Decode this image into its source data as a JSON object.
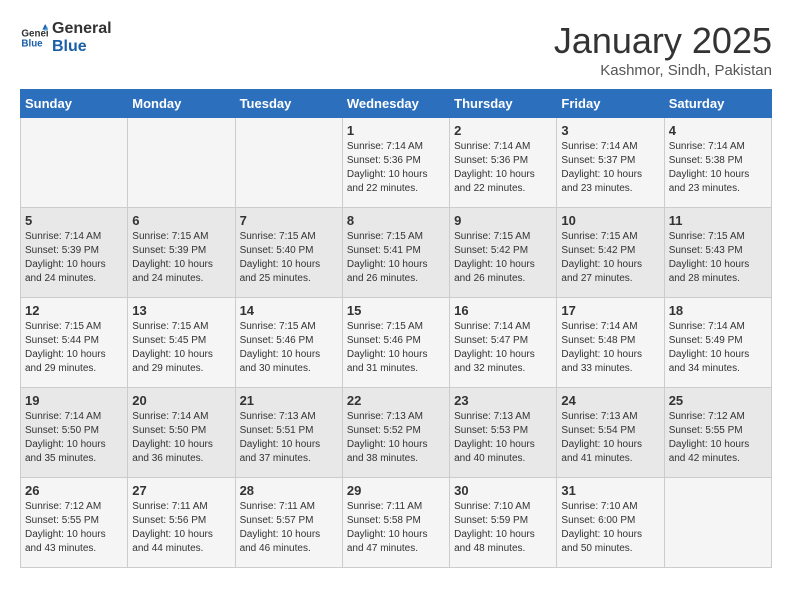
{
  "header": {
    "logo_line1": "General",
    "logo_line2": "Blue",
    "month_title": "January 2025",
    "subtitle": "Kashmor, Sindh, Pakistan"
  },
  "days_of_week": [
    "Sunday",
    "Monday",
    "Tuesday",
    "Wednesday",
    "Thursday",
    "Friday",
    "Saturday"
  ],
  "weeks": [
    [
      {
        "day": "",
        "info": ""
      },
      {
        "day": "",
        "info": ""
      },
      {
        "day": "",
        "info": ""
      },
      {
        "day": "1",
        "info": "Sunrise: 7:14 AM\nSunset: 5:36 PM\nDaylight: 10 hours\nand 22 minutes."
      },
      {
        "day": "2",
        "info": "Sunrise: 7:14 AM\nSunset: 5:36 PM\nDaylight: 10 hours\nand 22 minutes."
      },
      {
        "day": "3",
        "info": "Sunrise: 7:14 AM\nSunset: 5:37 PM\nDaylight: 10 hours\nand 23 minutes."
      },
      {
        "day": "4",
        "info": "Sunrise: 7:14 AM\nSunset: 5:38 PM\nDaylight: 10 hours\nand 23 minutes."
      }
    ],
    [
      {
        "day": "5",
        "info": "Sunrise: 7:14 AM\nSunset: 5:39 PM\nDaylight: 10 hours\nand 24 minutes."
      },
      {
        "day": "6",
        "info": "Sunrise: 7:15 AM\nSunset: 5:39 PM\nDaylight: 10 hours\nand 24 minutes."
      },
      {
        "day": "7",
        "info": "Sunrise: 7:15 AM\nSunset: 5:40 PM\nDaylight: 10 hours\nand 25 minutes."
      },
      {
        "day": "8",
        "info": "Sunrise: 7:15 AM\nSunset: 5:41 PM\nDaylight: 10 hours\nand 26 minutes."
      },
      {
        "day": "9",
        "info": "Sunrise: 7:15 AM\nSunset: 5:42 PM\nDaylight: 10 hours\nand 26 minutes."
      },
      {
        "day": "10",
        "info": "Sunrise: 7:15 AM\nSunset: 5:42 PM\nDaylight: 10 hours\nand 27 minutes."
      },
      {
        "day": "11",
        "info": "Sunrise: 7:15 AM\nSunset: 5:43 PM\nDaylight: 10 hours\nand 28 minutes."
      }
    ],
    [
      {
        "day": "12",
        "info": "Sunrise: 7:15 AM\nSunset: 5:44 PM\nDaylight: 10 hours\nand 29 minutes."
      },
      {
        "day": "13",
        "info": "Sunrise: 7:15 AM\nSunset: 5:45 PM\nDaylight: 10 hours\nand 29 minutes."
      },
      {
        "day": "14",
        "info": "Sunrise: 7:15 AM\nSunset: 5:46 PM\nDaylight: 10 hours\nand 30 minutes."
      },
      {
        "day": "15",
        "info": "Sunrise: 7:15 AM\nSunset: 5:46 PM\nDaylight: 10 hours\nand 31 minutes."
      },
      {
        "day": "16",
        "info": "Sunrise: 7:14 AM\nSunset: 5:47 PM\nDaylight: 10 hours\nand 32 minutes."
      },
      {
        "day": "17",
        "info": "Sunrise: 7:14 AM\nSunset: 5:48 PM\nDaylight: 10 hours\nand 33 minutes."
      },
      {
        "day": "18",
        "info": "Sunrise: 7:14 AM\nSunset: 5:49 PM\nDaylight: 10 hours\nand 34 minutes."
      }
    ],
    [
      {
        "day": "19",
        "info": "Sunrise: 7:14 AM\nSunset: 5:50 PM\nDaylight: 10 hours\nand 35 minutes."
      },
      {
        "day": "20",
        "info": "Sunrise: 7:14 AM\nSunset: 5:50 PM\nDaylight: 10 hours\nand 36 minutes."
      },
      {
        "day": "21",
        "info": "Sunrise: 7:13 AM\nSunset: 5:51 PM\nDaylight: 10 hours\nand 37 minutes."
      },
      {
        "day": "22",
        "info": "Sunrise: 7:13 AM\nSunset: 5:52 PM\nDaylight: 10 hours\nand 38 minutes."
      },
      {
        "day": "23",
        "info": "Sunrise: 7:13 AM\nSunset: 5:53 PM\nDaylight: 10 hours\nand 40 minutes."
      },
      {
        "day": "24",
        "info": "Sunrise: 7:13 AM\nSunset: 5:54 PM\nDaylight: 10 hours\nand 41 minutes."
      },
      {
        "day": "25",
        "info": "Sunrise: 7:12 AM\nSunset: 5:55 PM\nDaylight: 10 hours\nand 42 minutes."
      }
    ],
    [
      {
        "day": "26",
        "info": "Sunrise: 7:12 AM\nSunset: 5:55 PM\nDaylight: 10 hours\nand 43 minutes."
      },
      {
        "day": "27",
        "info": "Sunrise: 7:11 AM\nSunset: 5:56 PM\nDaylight: 10 hours\nand 44 minutes."
      },
      {
        "day": "28",
        "info": "Sunrise: 7:11 AM\nSunset: 5:57 PM\nDaylight: 10 hours\nand 46 minutes."
      },
      {
        "day": "29",
        "info": "Sunrise: 7:11 AM\nSunset: 5:58 PM\nDaylight: 10 hours\nand 47 minutes."
      },
      {
        "day": "30",
        "info": "Sunrise: 7:10 AM\nSunset: 5:59 PM\nDaylight: 10 hours\nand 48 minutes."
      },
      {
        "day": "31",
        "info": "Sunrise: 7:10 AM\nSunset: 6:00 PM\nDaylight: 10 hours\nand 50 minutes."
      },
      {
        "day": "",
        "info": ""
      }
    ]
  ]
}
